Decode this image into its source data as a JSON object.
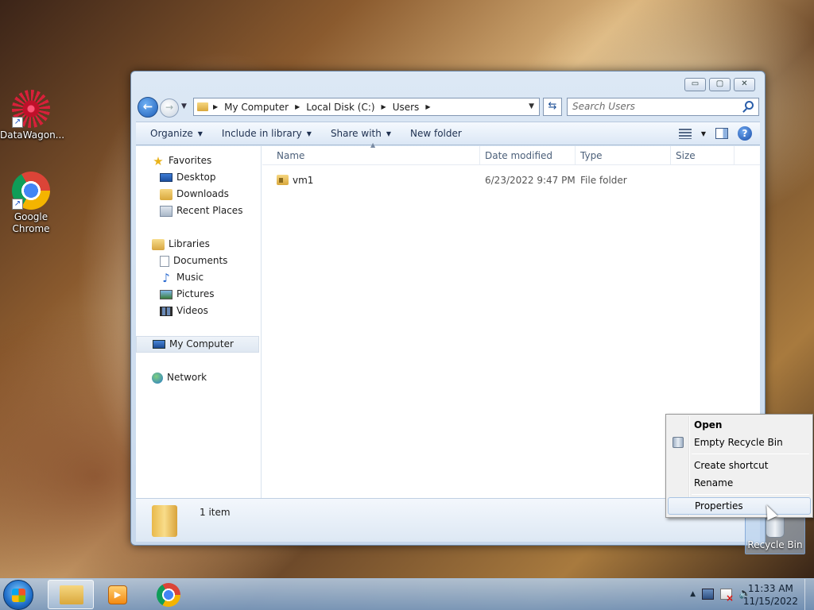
{
  "desktop": {
    "icons": [
      {
        "label": "DataWagon..."
      },
      {
        "label": "Google Chrome"
      }
    ],
    "recycle_bin_label": "Recycle Bin"
  },
  "window": {
    "controls": {
      "minimize": "▭",
      "maximize": "▢",
      "close": "✕"
    },
    "address": {
      "crumbs": [
        "My Computer",
        "Local Disk (C:)",
        "Users"
      ]
    },
    "search": {
      "placeholder": "Search Users"
    },
    "toolbar": {
      "organize": "Organize",
      "include_in_library": "Include in library",
      "share_with": "Share with",
      "new_folder": "New folder"
    },
    "nav": {
      "favorites": "Favorites",
      "desktop": "Desktop",
      "downloads": "Downloads",
      "recent_places": "Recent Places",
      "libraries": "Libraries",
      "documents": "Documents",
      "music": "Music",
      "pictures": "Pictures",
      "videos": "Videos",
      "my_computer": "My Computer",
      "network": "Network"
    },
    "columns": {
      "name": "Name",
      "date_modified": "Date modified",
      "type": "Type",
      "size": "Size"
    },
    "files": [
      {
        "name": "vm1",
        "date_modified": "6/23/2022 9:47 PM",
        "type": "File folder",
        "size": ""
      }
    ],
    "details": {
      "item_count": "1 item"
    }
  },
  "context_menu": {
    "open": "Open",
    "empty_recycle_bin": "Empty Recycle Bin",
    "create_shortcut": "Create shortcut",
    "rename": "Rename",
    "properties": "Properties"
  },
  "taskbar": {
    "clock_time": "11:33 AM",
    "clock_date": "11/15/2022"
  },
  "colors": {
    "accent": "#1f5fb8",
    "menu_hover_border": "#a8c3e3"
  }
}
